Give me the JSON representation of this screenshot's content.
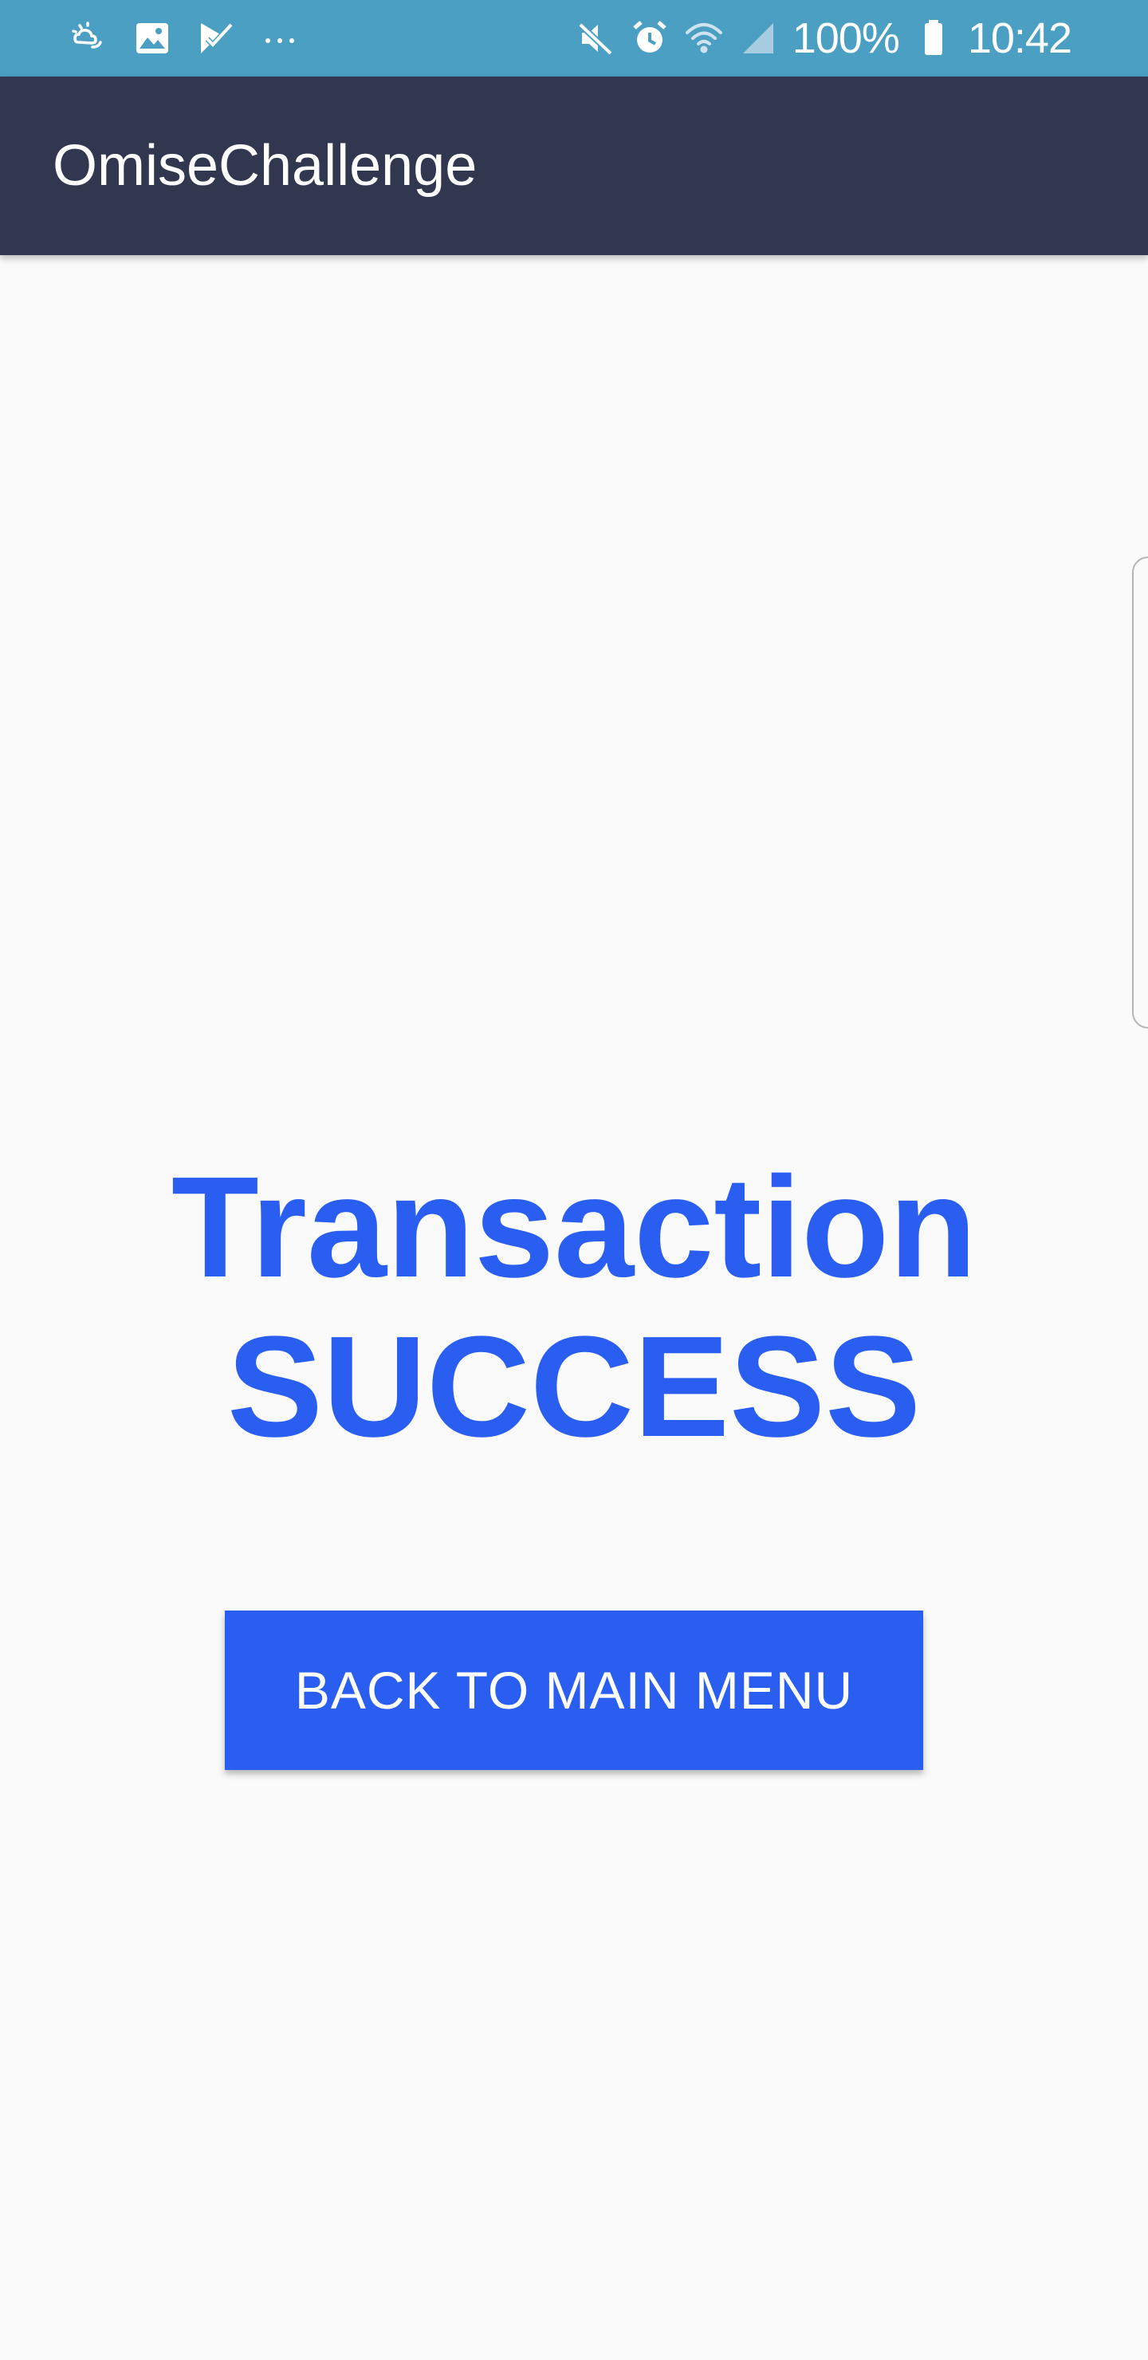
{
  "status_bar": {
    "left_icons": [
      "cloud-sun-icon",
      "image-icon",
      "task-check-icon",
      "more-dots-icon"
    ],
    "right_icons": [
      "mute-icon",
      "alarm-icon",
      "wifi-icon",
      "signal-icon"
    ],
    "battery_percent": "100%",
    "time": "10:42",
    "background_color": "#4a9fc2"
  },
  "app_bar": {
    "title": "OmiseChallenge",
    "background_color": "#30374f"
  },
  "main": {
    "headline_line1": "Transaction",
    "headline_line2": "SUCCESS",
    "headline_color": "#295ef0",
    "back_button_label": "BACK TO MAIN MENU",
    "button_color": "#295ef0"
  }
}
